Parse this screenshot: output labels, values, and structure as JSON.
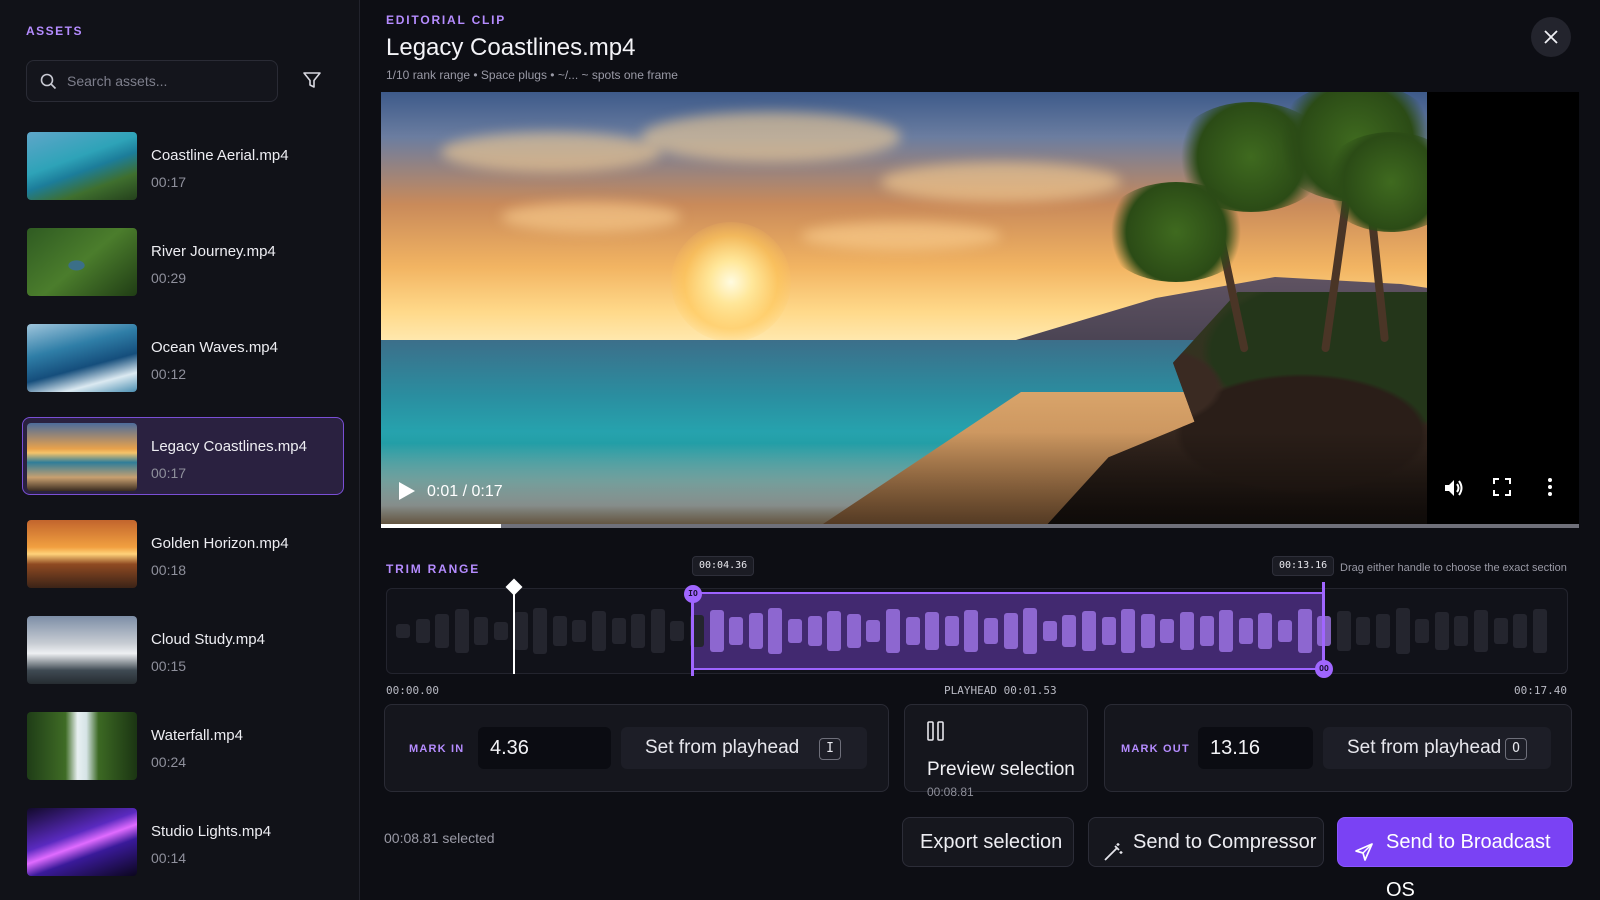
{
  "sidebar": {
    "title": "ASSETS",
    "search_placeholder": "Search assets...",
    "assets": [
      {
        "name": "Coastline Aerial.mp4",
        "duration": "00:17"
      },
      {
        "name": "River Journey.mp4",
        "duration": "00:29"
      },
      {
        "name": "Ocean Waves.mp4",
        "duration": "00:12"
      },
      {
        "name": "Legacy Coastlines.mp4",
        "duration": "00:17"
      },
      {
        "name": "Golden Horizon.mp4",
        "duration": "00:18"
      },
      {
        "name": "Cloud Study.mp4",
        "duration": "00:15"
      },
      {
        "name": "Waterfall.mp4",
        "duration": "00:24"
      },
      {
        "name": "Studio Lights.mp4",
        "duration": "00:14"
      }
    ],
    "selected_index": 3
  },
  "header": {
    "eyebrow": "EDITORIAL CLIP",
    "title": "Legacy Coastlines.mp4",
    "subtitle": "1/10 rank range • Space plugs • ~/... ~ spots one frame"
  },
  "player": {
    "timecode": "0:01 / 0:17",
    "progress_fraction": 0.1
  },
  "trim": {
    "label": "TRIM RANGE",
    "hint": "Drag either handle to choose the exact section",
    "in_tag": "00:04.36",
    "out_tag": "00:13.16",
    "in_knob": "IO",
    "out_knob": "OO",
    "start_time": "00:00.00",
    "playhead_time": "PLAYHEAD 00:01.53",
    "end_time": "00:17.40"
  },
  "mark_in": {
    "label": "MARK IN",
    "value": "4.36",
    "set_label": "Set from playhead",
    "shortcut": "I"
  },
  "preview": {
    "label": "Preview selection",
    "duration": "00:08.81"
  },
  "mark_out": {
    "label": "MARK OUT",
    "value": "13.16",
    "set_label": "Set from playhead",
    "shortcut": "O"
  },
  "footer": {
    "selected_text": "00:08.81 selected",
    "export_label": "Export selection",
    "compressor_label": "Send to Compressor",
    "broadcast_label": "Send to Broadcast OS"
  },
  "colors": {
    "accent": "#b58cff",
    "primary": "#7a42f4",
    "background": "#0d0e14"
  }
}
